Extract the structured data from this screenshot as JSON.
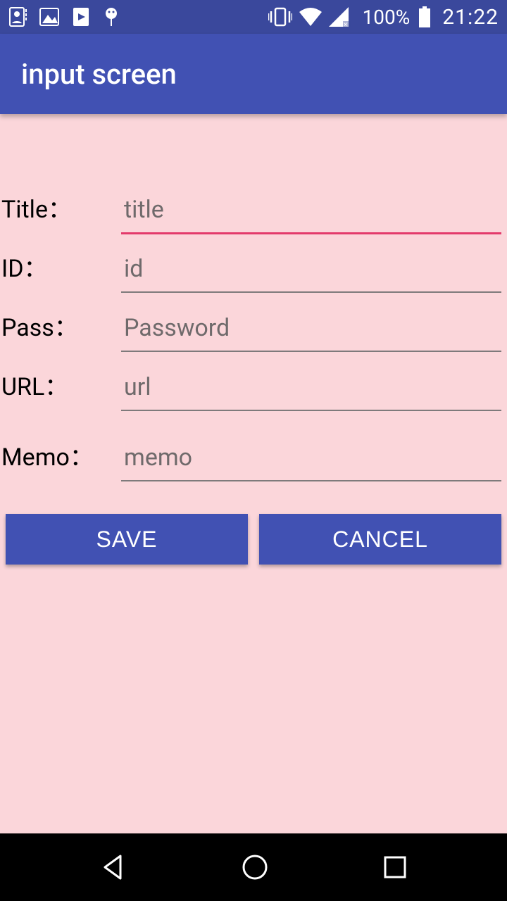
{
  "status": {
    "battery_pct": "100%",
    "clock": "21:22"
  },
  "appbar": {
    "title": "input screen"
  },
  "form": {
    "title": {
      "label": "Title：",
      "placeholder": "title"
    },
    "id": {
      "label": "ID：",
      "placeholder": "id"
    },
    "pass": {
      "label": "Pass：",
      "placeholder": "Password"
    },
    "url": {
      "label": "URL：",
      "placeholder": "url"
    },
    "memo": {
      "label": "Memo：",
      "placeholder": "memo"
    }
  },
  "buttons": {
    "save": "SAVE",
    "cancel": "CANCEL"
  }
}
